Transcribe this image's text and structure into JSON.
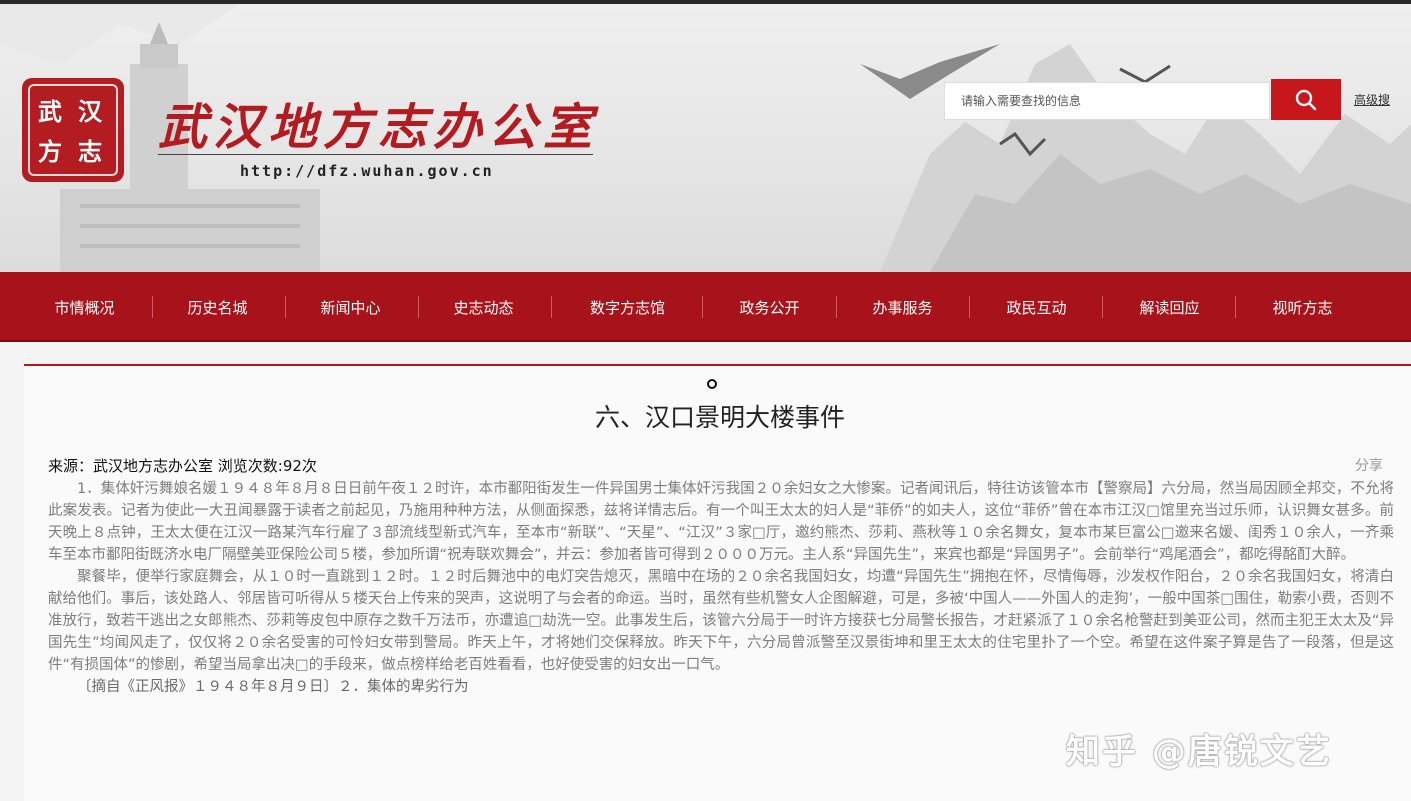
{
  "header": {
    "seal_text": "武汉方志",
    "site_title": "武汉地方志办公室",
    "site_url": "http://dfz.wuhan.gov.cn",
    "search_placeholder": "请输入需要查找的信息",
    "advanced_search": "高级搜"
  },
  "nav": {
    "items": [
      {
        "label": "市情概况"
      },
      {
        "label": "历史名城"
      },
      {
        "label": "新闻中心"
      },
      {
        "label": "史志动态"
      },
      {
        "label": "数字方志馆"
      },
      {
        "label": "政务公开"
      },
      {
        "label": "办事服务"
      },
      {
        "label": "政民互动"
      },
      {
        "label": "解读回应"
      },
      {
        "label": "视听方志"
      }
    ]
  },
  "article": {
    "title": "六、汉口景明大楼事件",
    "meta": "来源：武汉地方志办公室 浏览次数:92次",
    "share": "分享",
    "paragraphs": [
      "1．集体奸污舞娘名媛１９４８年８月８日日前午夜１２时许，本市鄱阳街发生一件异国男士集体奸污我国２０余妇女之大惨案。记者闻讯后，特往访该管本市【警察局】六分局，然当局因顾全邦交，不允将此案发表。记者为使此一大丑闻暴露于读者之前起见，乃施用种种方法，从侧面探悉，兹将详情志后。有一个叫王太太的妇人是“菲侨”的如夫人，这位“菲侨”曾在本市江汉□馆里充当过乐师，认识舞女甚多。前天晚上８点钟，王太太便在江汉一路某汽车行雇了３部流线型新式汽车，至本市“新联”、“天星”、“江汉”３家□厅，邀约熊杰、莎莉、燕秋等１０余名舞女，复本市某巨富公□邀来名媛、闺秀１０余人，一齐乘车至本市鄱阳街既济水电厂隔壁美亚保险公司５楼，参加所谓“祝寿联欢舞会”，并云：参加者皆可得到２０００万元。主人系“异国先生”，来宾也都是“异国男子”。会前举行“鸡尾酒会”，都吃得酩酊大醉。",
      "聚餐毕，便举行家庭舞会，从１０时一直跳到１２时。１２时后舞池中的电灯突告熄灭，黑暗中在场的２０余名我国妇女，均遭“异国先生”拥抱在怀，尽情侮辱，沙发权作阳台，２０余名我国妇女，将清白献给他们。事后，该处路人、邻居皆可听得从５楼天台上传来的哭声，这说明了与会者的命运。当时，虽然有些机警女人企图解避，可是，多被‘中国人——外国人的走狗’，一般中国茶□围住，勒索小费，否则不准放行，致若干逃出之女郎熊杰、莎莉等皮包中原存之数千万法币，亦遭追□劫洗一空。此事发生后，该管六分局于一时许方接获七分局警长报告，才赶紧派了１０余名枪警赶到美亚公司，然而主犯王太太及“异国先生”均闻风走了，仅仅将２０余名受害的可怜妇女带到警局。昨天上午，才将她们交保释放。昨天下午，六分局曾派警至汉景街坤和里王太太的住宅里扑了一个空。希望在这件案子算是告了一段落，但是这件“有损国体”的惨剧，希望当局拿出决□的手段来，做点榜样给老百姓看看，也好使受害的妇女出一口气。",
      "〔摘自《正风报》１９４８年８月９日〕２．集体的卑劣行为"
    ]
  },
  "watermark": "知乎 @唐锐文艺"
}
